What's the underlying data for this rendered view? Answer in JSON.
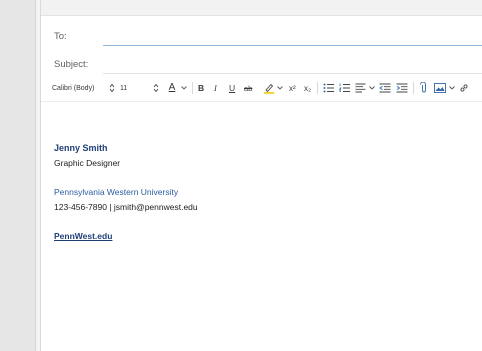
{
  "header": {
    "to_label": "To:",
    "to_value": "",
    "subject_label": "Subject:",
    "subject_value": ""
  },
  "toolbar": {
    "font_family": "Calibri (Body)",
    "font_size": "11",
    "font_color_glyph": "A",
    "bold": "B",
    "italic": "I",
    "underline": "U",
    "strikethrough": "ab",
    "superscript": "x²",
    "subscript": "x₂",
    "icons": [
      "stepper-icon",
      "chevron-down-icon",
      "pen-highlight-icon",
      "bullet-list-icon",
      "numbered-list-icon",
      "align-icon",
      "outdent-icon",
      "indent-icon",
      "attach-icon",
      "image-icon",
      "link-icon"
    ]
  },
  "signature": {
    "name": "Jenny Smith",
    "title": "Graphic Designer",
    "organization": "Pennsylvania Western University",
    "contact": "123-456-7890 | jsmith@pennwest.edu",
    "website": "PennWest.edu"
  },
  "colors": {
    "name_color": "#1f3f78",
    "org_color": "#2a5d9f",
    "to_underline": "#8fb4da",
    "highlight_yellow": "#f2d21a",
    "font_color_red": "#d83b3b"
  }
}
